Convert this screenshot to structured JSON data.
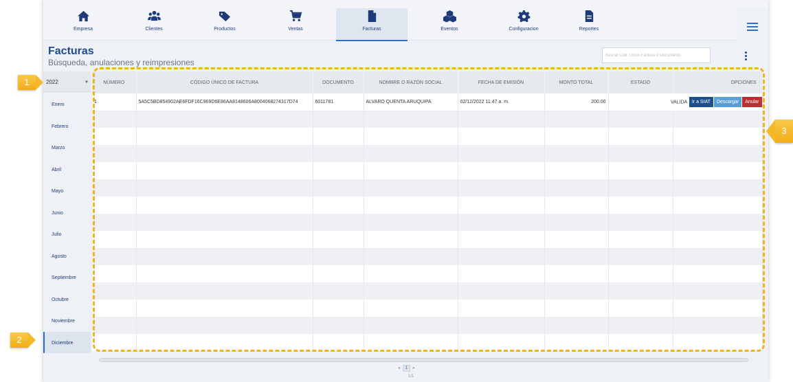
{
  "nav": {
    "items": [
      {
        "label": "Empresa",
        "icon": "home-icon"
      },
      {
        "label": "Clientes",
        "icon": "users-icon"
      },
      {
        "label": "Productos",
        "icon": "tags-icon"
      },
      {
        "label": "Ventas",
        "icon": "cart-icon"
      },
      {
        "label": "Facturas",
        "icon": "file-icon"
      },
      {
        "label": "Eventos",
        "icon": "cubes-icon"
      },
      {
        "label": "Configuracion",
        "icon": "gear-icon"
      },
      {
        "label": "Reportes",
        "icon": "report-icon"
      }
    ],
    "active": "Facturas",
    "menu_icon": "hamburger-icon"
  },
  "header": {
    "title": "Facturas",
    "subtitle": "Búsqueda, anulaciones y reimpresiones",
    "search_placeholder": "Buscar Cód. Único Factura o Documento"
  },
  "sidebar": {
    "year": "2022",
    "months": [
      "Enero",
      "Febrero",
      "Marzo",
      "Abril",
      "Mayo",
      "Junio",
      "Julio",
      "Agosto",
      "Septiembre",
      "Octubre",
      "Noviembre",
      "Diciembre"
    ],
    "active_month": "Diciembre"
  },
  "table": {
    "headers": [
      "NÚMERO",
      "CÓDIGO ÚNICO DE FACTURA",
      "DOCUMENTO",
      "NOMBRE O RAZÓN SOCIAL",
      "FECHA DE EMISIÓN",
      "MONTO TOTAL",
      "ESTADO",
      "OPCIONES"
    ],
    "rows": [
      {
        "numero": "1",
        "codigo": "5A5C5BD854902AE6FDF16C969D6E86AA8148606A8004068274317D74",
        "documento": "6011781",
        "nombre": "ALVARO QUENTA ARUQUIPA",
        "fecha": "02/12/2022 11:47 a. m.",
        "monto": "200.00",
        "estado": "VALIDA",
        "buttons": [
          "Ir a SIAT",
          "Descargar",
          "Anular"
        ]
      }
    ]
  },
  "pagination": {
    "prev": "◂",
    "current": "1",
    "next": "▸",
    "count": "1/1"
  },
  "markers": [
    "1",
    "2",
    "3"
  ],
  "colors": {
    "brand": "#1f4c8f",
    "accent": "#2a6fc7",
    "highlight": "#f1b31c",
    "danger": "#b83232",
    "info": "#5aa0d8"
  }
}
